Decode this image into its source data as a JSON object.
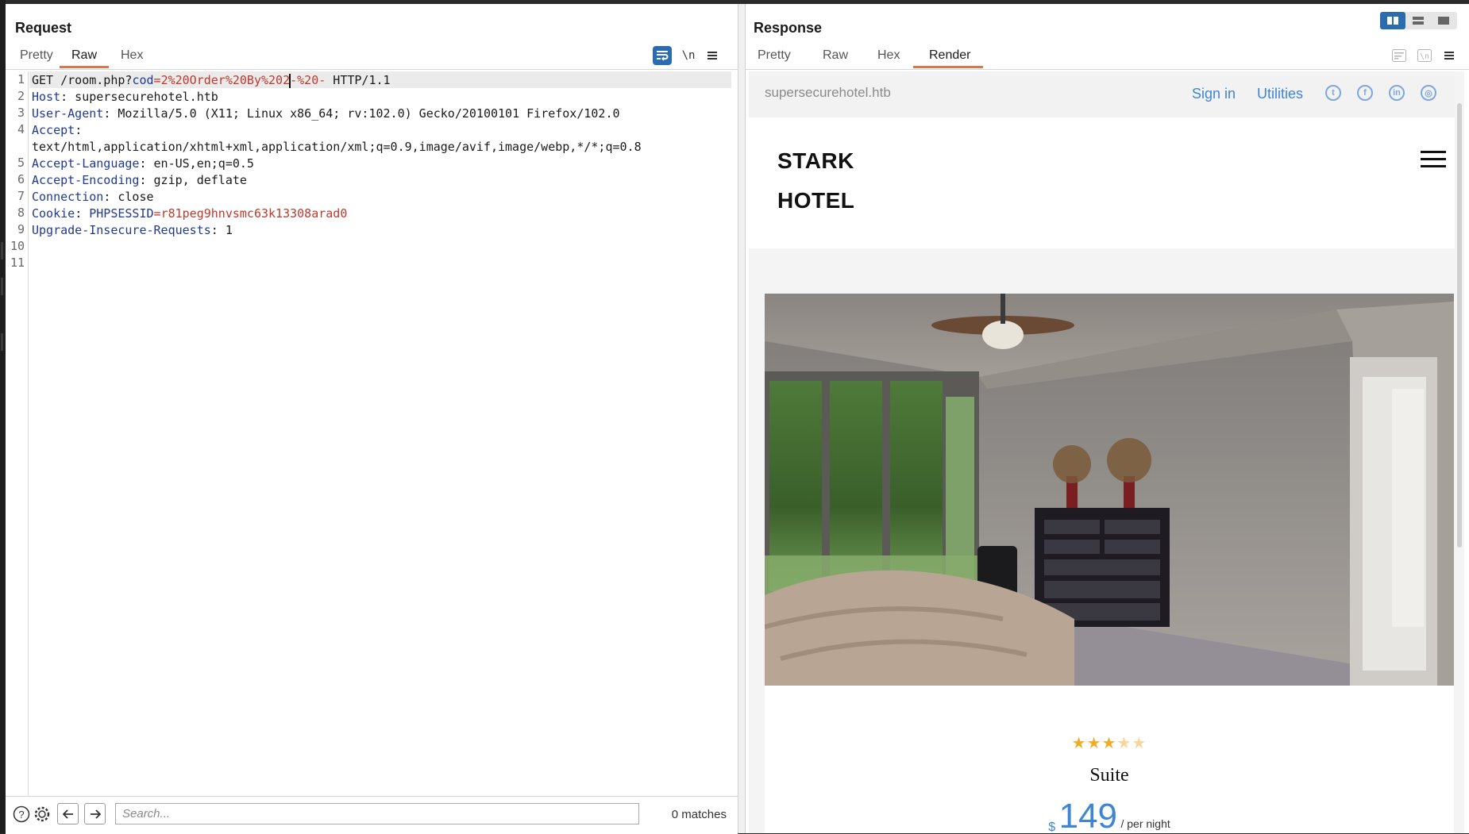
{
  "request": {
    "title": "Request",
    "tabs": [
      "Pretty",
      "Raw",
      "Hex"
    ],
    "active_tab": "Raw",
    "newline_label": "\\n",
    "line_numbers": [
      "1",
      "2",
      "3",
      "4",
      "5",
      "6",
      "7",
      "8",
      "9",
      "10",
      "11"
    ],
    "lines": {
      "l1_method": "GET /room.php?",
      "l1_param": "cod",
      "l1_eq": "=",
      "l1_val_a": "2%20Order%20By%202",
      "l1_val_b": "-%20-",
      "l1_proto": " HTTP/1.1",
      "l2_name": "Host",
      "l2_val": ": supersecurehotel.htb",
      "l3_name": "User-Agent",
      "l3_val": ": Mozilla/5.0 (X11; Linux x86_64; rv:102.0) Gecko/20100101 Firefox/102.0",
      "l4_name": "Accept",
      "l4_colon": ":",
      "l4_cont": "text/html,application/xhtml+xml,application/xml;q=0.9,image/avif,image/webp,*/*;q=0.8",
      "l5_name": "Accept-Language",
      "l5_val": ": en-US,en;q=0.5",
      "l6_name": "Accept-Encoding",
      "l6_val": ": gzip, deflate",
      "l7_name": "Connection",
      "l7_val": ": close",
      "l8_name": "Cookie",
      "l8_colon": ": ",
      "l8_cname": "PHPSESSID",
      "l8_eq": "=",
      "l8_cval": "r81peg9hnvsmc63k13308arad0",
      "l9_name": "Upgrade-Insecure-Requests",
      "l9_val": ": 1"
    },
    "search": {
      "placeholder": "Search...",
      "matches": "0 matches"
    }
  },
  "response": {
    "title": "Response",
    "tabs": [
      "Pretty",
      "Raw",
      "Hex",
      "Render"
    ],
    "active_tab": "Render",
    "render": {
      "domain": "supersecurehotel.htb",
      "links": [
        "Sign in",
        "Utilities"
      ],
      "social_icons": [
        "twitter-icon",
        "facebook-icon",
        "linkedin-icon",
        "instagram-icon"
      ],
      "brand_line1": "STARK",
      "brand_line2": "HOTEL",
      "rating": 3,
      "rating_max": 5,
      "room_name": "Suite",
      "currency": "$",
      "price": "149",
      "per": "/ per night"
    }
  },
  "colors": {
    "accent": "#e0734a",
    "active_blue": "#2b6cb0",
    "link_blue": "#3f85d6",
    "param_red": "#c0392b",
    "header_blue": "#1f3a93"
  }
}
